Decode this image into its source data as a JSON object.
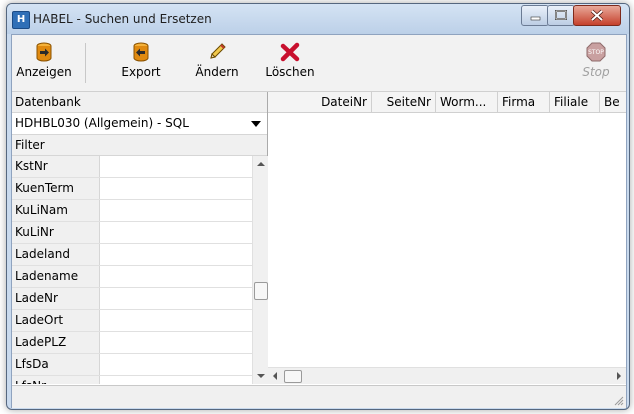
{
  "window": {
    "title": "HABEL - Suchen und Ersetzen",
    "app_icon_text": "H"
  },
  "toolbar": {
    "items": [
      {
        "label": "Anzeigen",
        "icon": "database-view-icon",
        "enabled": true
      },
      {
        "label": "Export",
        "icon": "database-export-icon",
        "enabled": true
      },
      {
        "label": "Ändern",
        "icon": "pencil-icon",
        "enabled": true
      },
      {
        "label": "Löschen",
        "icon": "delete-x-icon",
        "enabled": true
      },
      {
        "label": "Stop",
        "icon": "stop-sign-icon",
        "enabled": false
      }
    ]
  },
  "left_panel": {
    "database_header": "Datenbank",
    "database_selected": "HDHBL030 (Allgemein) - SQL",
    "filter_header": "Filter",
    "filter_fields": [
      "KstNr",
      "KuenTerm",
      "KuLiNam",
      "KuLiNr",
      "Ladeland",
      "Ladename",
      "LadeNr",
      "LadeOrt",
      "LadePLZ",
      "LfsDa",
      "LfsNr"
    ]
  },
  "grid": {
    "columns": [
      "DateiNr",
      "SeiteNr",
      "Worm...",
      "Firma",
      "Filiale",
      "Be"
    ]
  },
  "colors": {
    "close_button": "#c5412c",
    "delete_icon": "#c8102e",
    "stop_icon": "#c0392b",
    "database_icon": "#e08a10"
  }
}
